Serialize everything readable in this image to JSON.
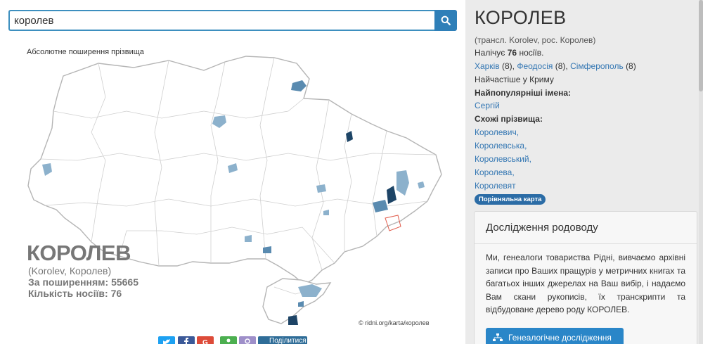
{
  "search": {
    "value": "королев"
  },
  "map": {
    "caption": "Абсолютне поширення прізвища",
    "overlay_name": "КОРОЛЕВ",
    "overlay_translit": "(Korolev, Королев)",
    "spread_label": "За поширенням:",
    "spread_value": "55665",
    "bearers_label": "Кількість носіїв:",
    "bearers_value": "76",
    "credit": "© ridni.org/karta/королев",
    "colors": {
      "border": "#b5b5b5",
      "region": "#d9d9d9",
      "light": "#8cb1cc",
      "medium": "#5a8bb0",
      "dark": "#1d4466",
      "highlight": "#e05a4a"
    }
  },
  "share": {
    "label": "Поділитися"
  },
  "panel": {
    "title": "КОРОЛЕВ",
    "translit": "(трансл. Korolev, рос. Королев)",
    "count_prefix": "Налічує",
    "count_value": "76",
    "count_suffix": "носіїв.",
    "cities": [
      {
        "name": "Харків",
        "count": "(8)"
      },
      {
        "name": "Феодосія",
        "count": "(8)"
      },
      {
        "name": "Сімферополь",
        "count": "(8)"
      }
    ],
    "most_common": "Найчастіше у Криму",
    "popular_names_label": "Найпопулярніші імена:",
    "popular_names": [
      "Сергій"
    ],
    "similar_label": "Схожі прізвища:",
    "similar": [
      "Королевич,",
      "Королевська,",
      "Королевський,",
      "Королева,",
      "Королевят"
    ],
    "compare_badge": "Порівняльна карта",
    "card": {
      "title": "Дослідження родоводу",
      "text": "Ми, генеалоги товариства Рідні, вивчаємо архівні записи про Ваших пращурів у метричних книгах та багатьох інших джерелах на Ваш вибір, і надаємо Вам скани рукописів, їх транскрипти та відбудоване дерево роду КОРОЛЕВ.",
      "button": "Генеалогічне дослідження"
    }
  }
}
